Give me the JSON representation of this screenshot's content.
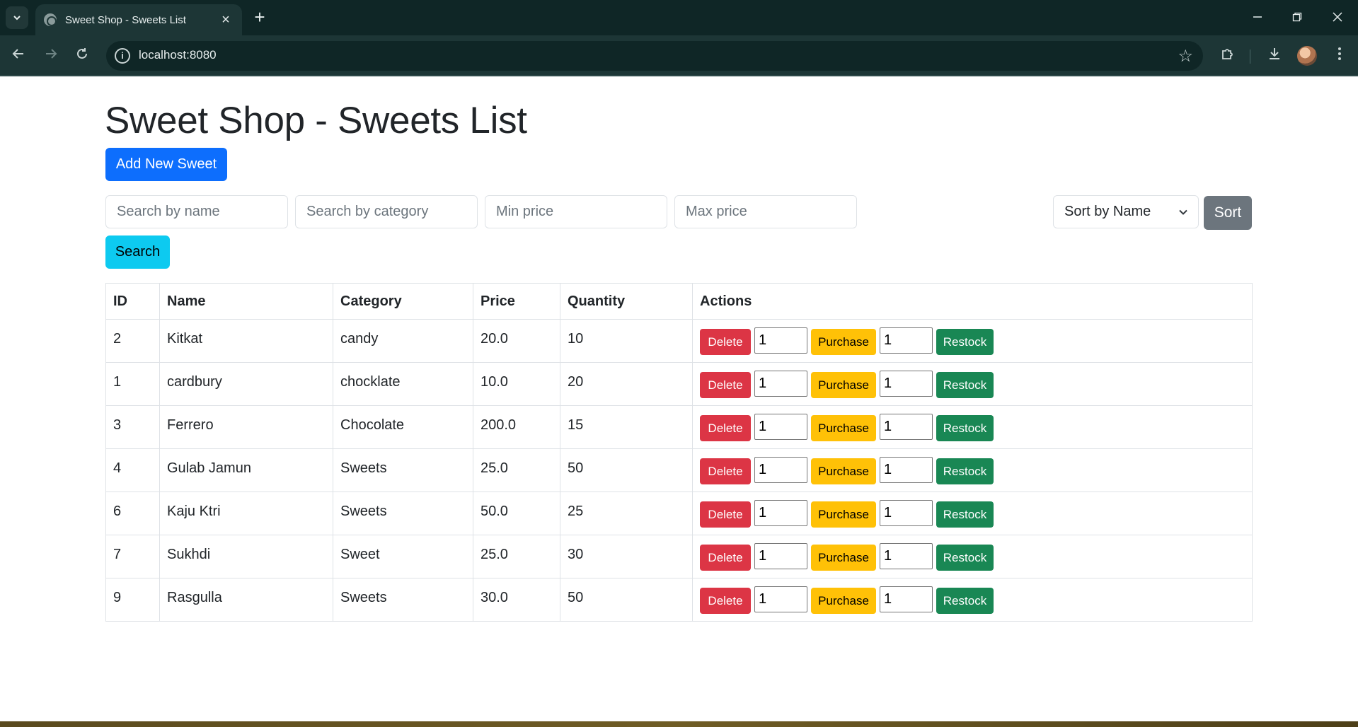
{
  "browser": {
    "tab_title": "Sweet Shop - Sweets List",
    "url": "localhost:8080",
    "icons": {
      "tab_menu": "chevron-down-icon",
      "favicon": "globe-icon",
      "close": "close-icon",
      "new_tab": "plus-icon",
      "minimize": "minimize-icon",
      "restore": "restore-icon",
      "window_close": "close-icon",
      "back": "arrow-left-icon",
      "forward": "arrow-right-icon",
      "reload": "reload-icon",
      "site_info": "info-icon",
      "bookmark": "star-icon",
      "extensions": "puzzle-icon",
      "downloads": "download-icon",
      "profile": "avatar",
      "menu": "more-vertical-icon"
    }
  },
  "page": {
    "title": "Sweet Shop - Sweets List",
    "add_button": "Add New Sweet"
  },
  "filters": {
    "name_placeholder": "Search by name",
    "category_placeholder": "Search by category",
    "min_price_placeholder": "Min price",
    "max_price_placeholder": "Max price",
    "search_button": "Search",
    "sort_select": "Sort by Name",
    "sort_button": "Sort"
  },
  "table": {
    "headers": [
      "ID",
      "Name",
      "Category",
      "Price",
      "Quantity",
      "Actions"
    ],
    "rows": [
      {
        "id": "2",
        "name": "Kitkat",
        "category": "candy",
        "price": "20.0",
        "quantity": "10",
        "purchase_qty": "1",
        "restock_qty": "1"
      },
      {
        "id": "1",
        "name": "cardbury",
        "category": "chocklate",
        "price": "10.0",
        "quantity": "20",
        "purchase_qty": "1",
        "restock_qty": "1"
      },
      {
        "id": "3",
        "name": "Ferrero",
        "category": "Chocolate",
        "price": "200.0",
        "quantity": "15",
        "purchase_qty": "1",
        "restock_qty": "1"
      },
      {
        "id": "4",
        "name": "Gulab Jamun",
        "category": "Sweets",
        "price": "25.0",
        "quantity": "50",
        "purchase_qty": "1",
        "restock_qty": "1"
      },
      {
        "id": "6",
        "name": "Kaju Ktri",
        "category": "Sweets",
        "price": "50.0",
        "quantity": "25",
        "purchase_qty": "1",
        "restock_qty": "1"
      },
      {
        "id": "7",
        "name": "Sukhdi",
        "category": "Sweet",
        "price": "25.0",
        "quantity": "30",
        "purchase_qty": "1",
        "restock_qty": "1"
      },
      {
        "id": "9",
        "name": "Rasgulla",
        "category": "Sweets",
        "price": "30.0",
        "quantity": "50",
        "purchase_qty": "1",
        "restock_qty": "1"
      }
    ],
    "actions": {
      "delete_label": "Delete",
      "purchase_label": "Purchase",
      "restock_label": "Restock"
    }
  },
  "colors": {
    "primary": "#0d6efd",
    "info": "#0dcaf0",
    "secondary": "#6c757d",
    "danger": "#dc3545",
    "warning": "#ffc107",
    "success": "#198754",
    "chrome_dark": "#0f2626"
  }
}
